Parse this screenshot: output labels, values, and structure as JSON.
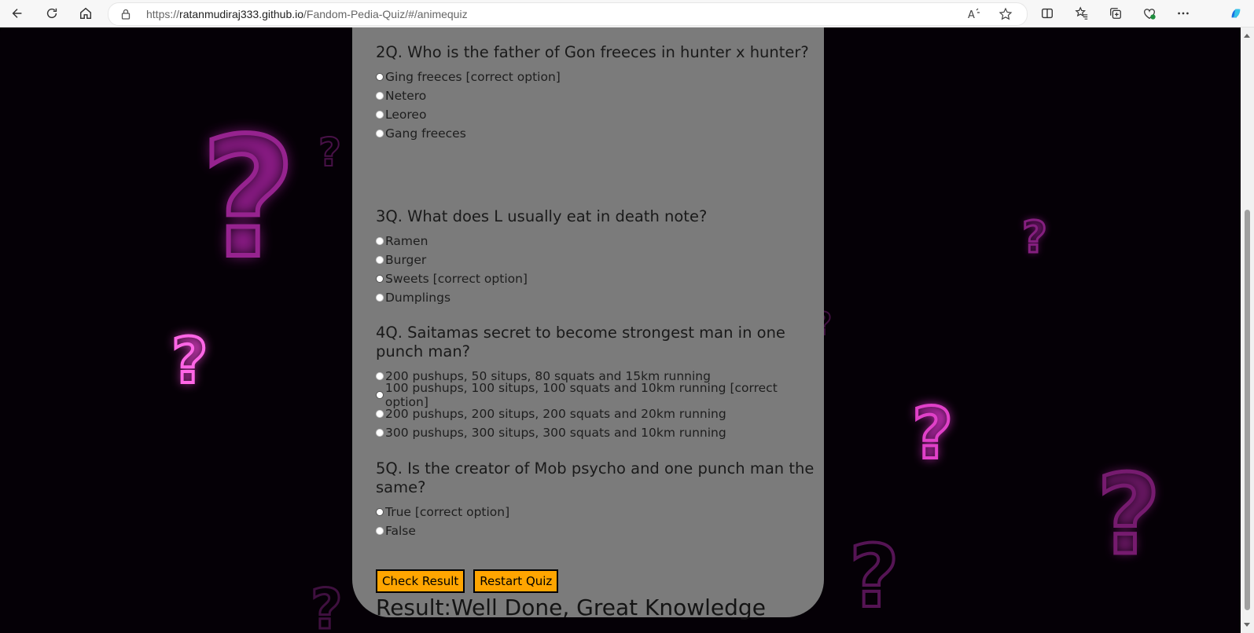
{
  "browser": {
    "url_prefix": "https://",
    "url_host": "ratanmudiraj333.github.io",
    "url_path": "/Fandom-Pedia-Quiz/#/animequiz"
  },
  "quiz": {
    "questions": [
      {
        "title": "2Q. Who is the father of Gon freeces in hunter x hunter?",
        "options": [
          "Ging freeces [correct option]",
          "Netero",
          "Leoreo",
          "Gang freeces"
        ]
      },
      {
        "title": "3Q. What does L usually eat in death note?",
        "options": [
          "Ramen",
          "Burger",
          "Sweets [correct option]",
          "Dumplings"
        ]
      },
      {
        "title": "4Q. Saitamas secret to become strongest man in one punch man?",
        "options": [
          "200 pushups, 50 situps, 80 squats and 15km running",
          "100 pushups, 100 situps, 100 squats and 10km running [correct option]",
          "200 pushups, 200 situps, 200 squats and 20km running",
          "300 pushups, 300 situps, 300 squats and 10km running"
        ]
      },
      {
        "title": "5Q. Is the creator of Mob psycho and one punch man the same?",
        "options": [
          "True [correct option]",
          "False"
        ]
      }
    ],
    "check_label": "Check Result",
    "restart_label": "Restart Quiz",
    "result_label": "Result:",
    "result_text": "Well Done, Great Knowledge"
  },
  "colors": {
    "card": "#7b7b7b",
    "button": "#ffa500",
    "neon": "#e040c8"
  },
  "icons": [
    "back-icon",
    "refresh-icon",
    "home-icon",
    "lock-icon",
    "read-aloud-icon",
    "favorite-star-icon",
    "split-screen-icon",
    "favorites-icon",
    "collections-icon",
    "browser-essentials-icon",
    "more-icon",
    "copilot-icon"
  ]
}
